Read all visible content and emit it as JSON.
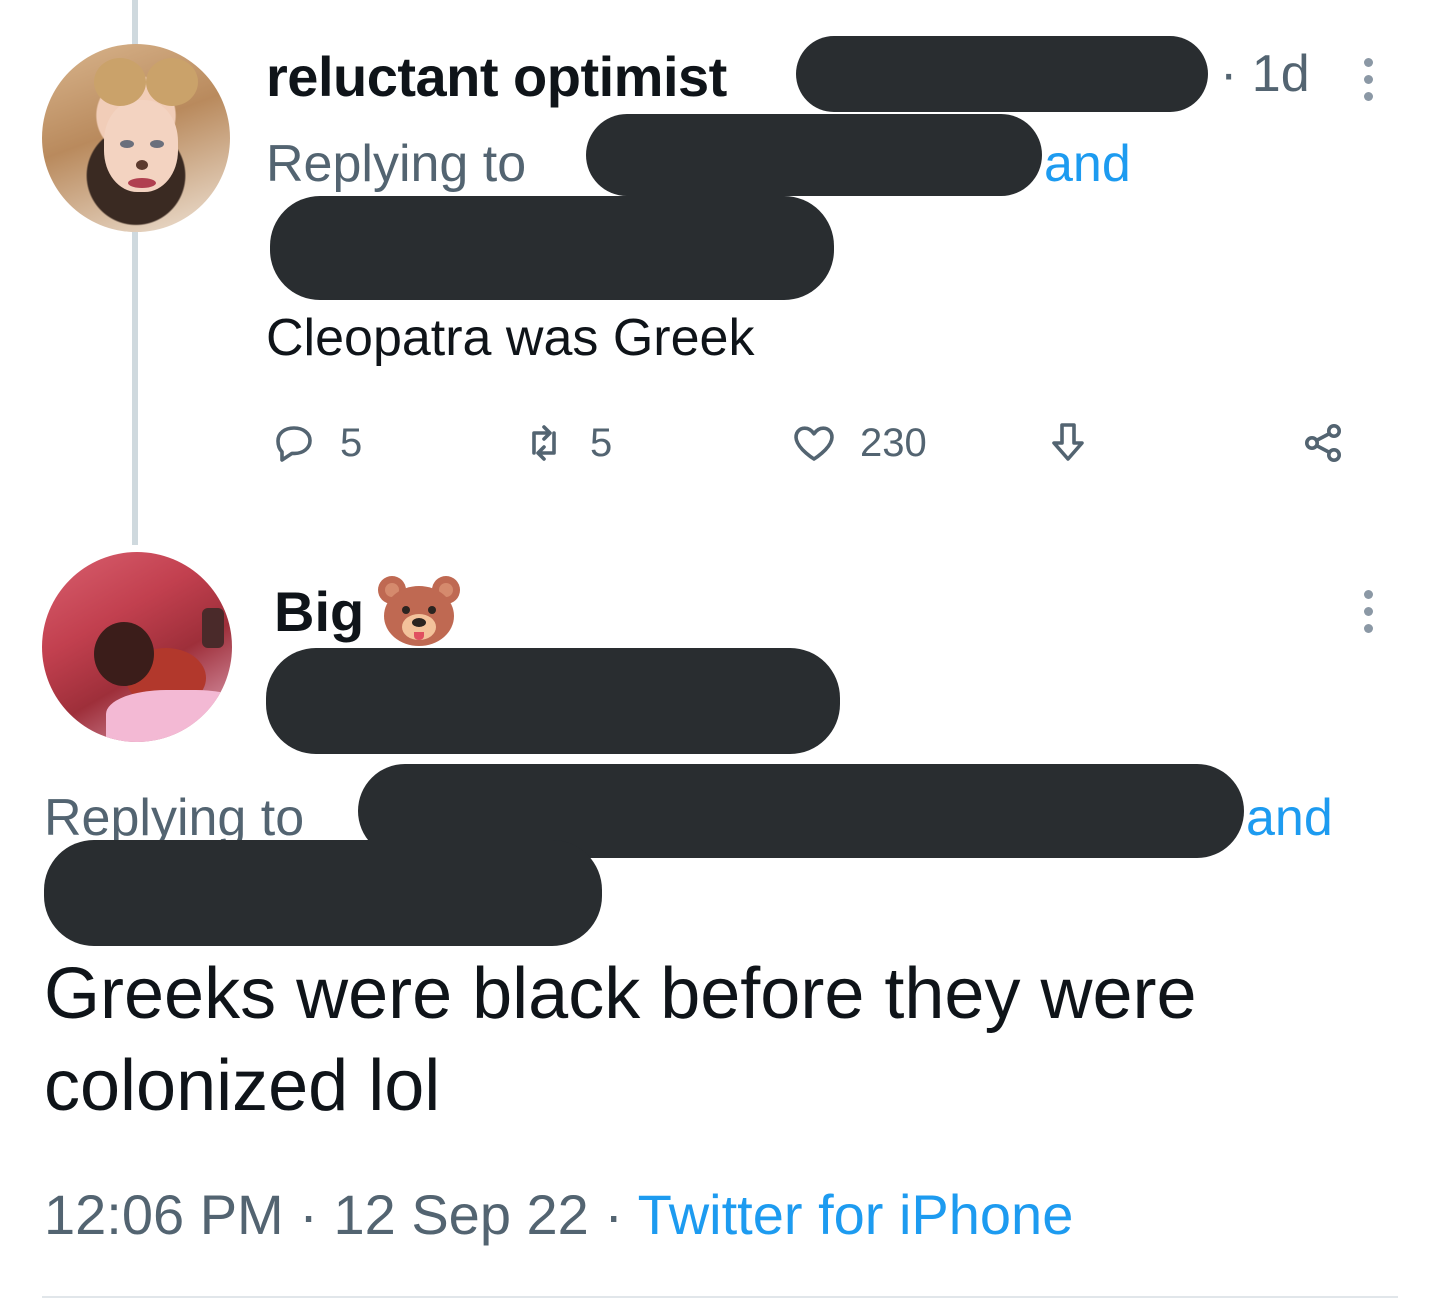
{
  "reply_tweet": {
    "author_name": "reluctant optimist",
    "timestamp": "1d",
    "timestamp_separator": "·",
    "replying_to_label": "Replying to",
    "and_label": "and",
    "text": "Cleopatra was Greek",
    "actions": {
      "reply_count": "5",
      "retweet_count": "5",
      "like_count": "230"
    }
  },
  "main_tweet": {
    "author_name": "Big",
    "author_emoji": "bear-face",
    "replying_to_label": "Replying to",
    "and_label": "and",
    "text": "Greeks were black before they were colonized lol",
    "time": "12:06 PM",
    "date": "12 Sep 22",
    "separator": "·",
    "source": "Twitter for iPhone"
  },
  "colors": {
    "link": "#1d9bf0",
    "secondary_text": "#536471",
    "redaction": "#292d30",
    "thread_line": "#cfd9de"
  }
}
